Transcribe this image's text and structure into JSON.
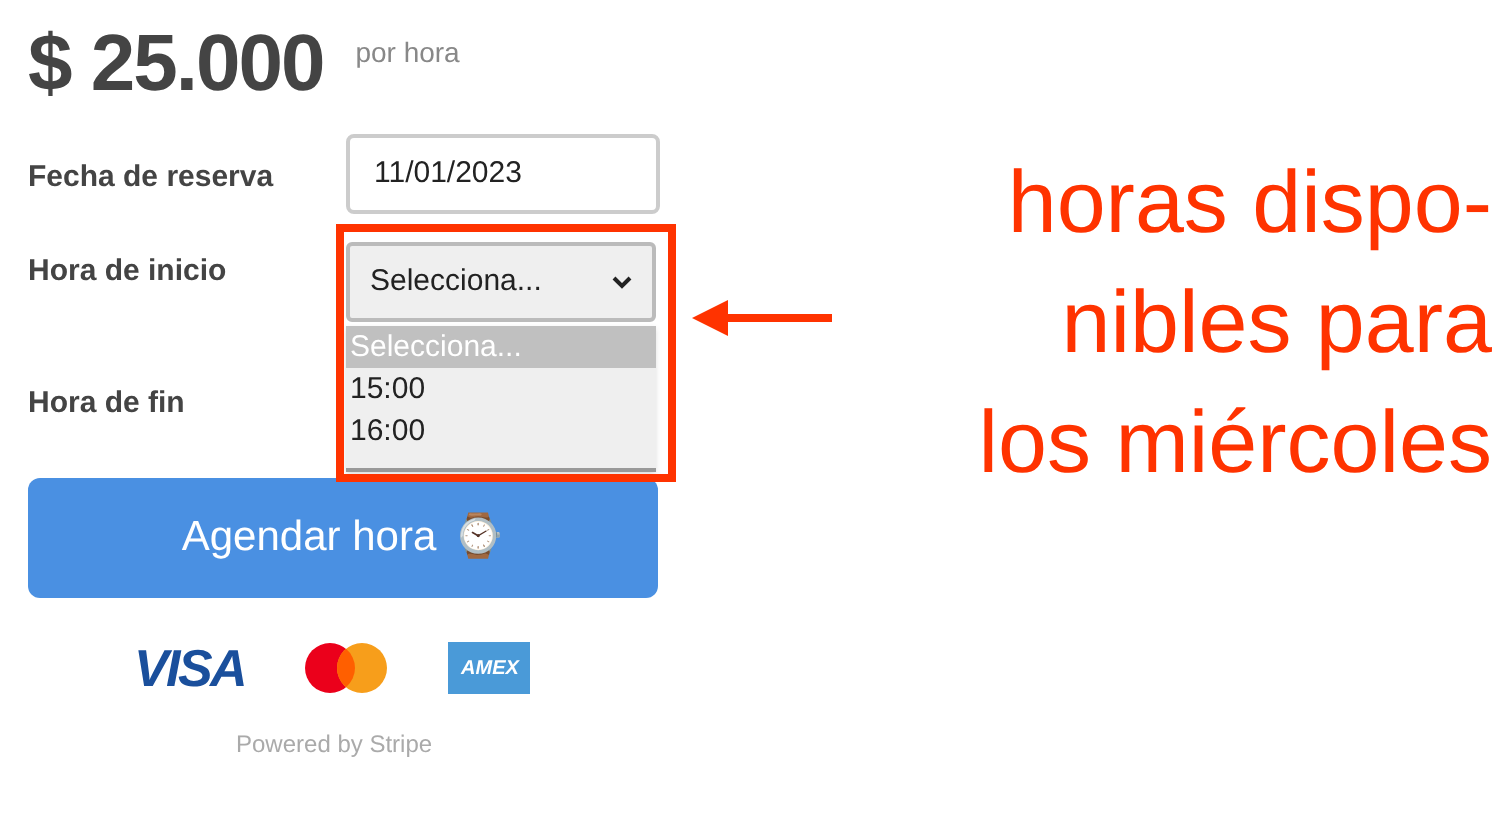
{
  "price": {
    "amount": "$ 25.000",
    "unit": "por hora"
  },
  "fields": [
    {
      "label": "Fecha de reserva",
      "kind": "input",
      "value": "11/01/2023"
    },
    {
      "label": "Hora de inicio",
      "kind": "select",
      "value": "Selecciona...",
      "expanded": true,
      "options": [
        {
          "label": "Selecciona...",
          "selected": true
        },
        {
          "label": "15:00",
          "selected": false
        },
        {
          "label": "16:00",
          "selected": false
        }
      ]
    },
    {
      "label": "Hora de fin",
      "kind": "empty"
    }
  ],
  "button": {
    "label": "Agendar hora",
    "emoji": "⌚"
  },
  "payment_logos": [
    {
      "kind": "visa",
      "text": "VISA"
    },
    {
      "kind": "mastercard"
    },
    {
      "kind": "amex",
      "text": "AMEX"
    }
  ],
  "powered_by": "Powered by Stripe",
  "annotation_lines": [
    "horas dispo-",
    "nibles para",
    "los miércoles"
  ]
}
